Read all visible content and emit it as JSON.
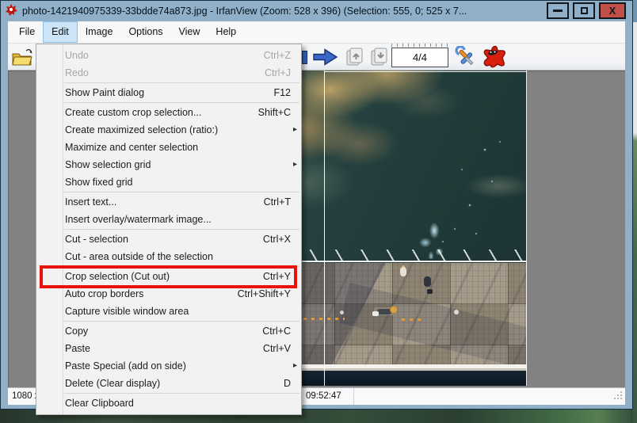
{
  "titlebar": {
    "title": "photo-1421940975339-33bdde74a873.jpg - IrfanView (Zoom: 528 x 396) (Selection: 555, 0; 525 x 7...",
    "close_label": "X"
  },
  "menubar": {
    "items": [
      "File",
      "Edit",
      "Image",
      "Options",
      "View",
      "Help"
    ],
    "active_item": "Edit"
  },
  "toolbar": {
    "page_counter": "4/4",
    "icons": [
      "open-folder-icon",
      "prev-file-icon",
      "next-file-icon",
      "page-up-icon",
      "page-down-icon",
      "settings-wrench-icon",
      "irfanview-mascot-icon"
    ]
  },
  "edit_menu": {
    "items": [
      {
        "label": "Undo",
        "shortcut": "Ctrl+Z",
        "disabled": true
      },
      {
        "label": "Redo",
        "shortcut": "Ctrl+J",
        "disabled": true
      },
      {
        "type": "separator"
      },
      {
        "label": "Show Paint dialog",
        "shortcut": "F12"
      },
      {
        "type": "separator"
      },
      {
        "label": "Create custom crop selection...",
        "shortcut": "Shift+C"
      },
      {
        "label": "Create maximized selection (ratio:)",
        "submenu": true
      },
      {
        "label": "Maximize and center selection"
      },
      {
        "label": "Show selection grid",
        "submenu": true
      },
      {
        "label": "Show fixed grid"
      },
      {
        "type": "separator"
      },
      {
        "label": "Insert text...",
        "shortcut": "Ctrl+T"
      },
      {
        "label": "Insert overlay/watermark image..."
      },
      {
        "type": "separator"
      },
      {
        "label": "Cut - selection",
        "shortcut": "Ctrl+X"
      },
      {
        "label": "Cut - area outside of the selection"
      },
      {
        "type": "separator"
      },
      {
        "label": "Crop selection (Cut out)",
        "shortcut": "Ctrl+Y",
        "highlighted": true
      },
      {
        "label": "Auto crop borders",
        "shortcut": "Ctrl+Shift+Y"
      },
      {
        "label": "Capture visible window area"
      },
      {
        "type": "separator"
      },
      {
        "label": "Copy",
        "shortcut": "Ctrl+C"
      },
      {
        "label": "Paste",
        "shortcut": "Ctrl+V"
      },
      {
        "label": "Paste Special (add on side)",
        "submenu": true
      },
      {
        "label": "Delete (Clear display)",
        "shortcut": "D"
      },
      {
        "type": "separator"
      },
      {
        "label": "Clear Clipboard"
      }
    ]
  },
  "statusbar": {
    "image_info": "1080 x",
    "time": "09:52:47"
  },
  "colors": {
    "annotation_red": "#e8130c",
    "titlebar_blue": "#8fb0c8",
    "close_button_red": "#c05048",
    "canvas_gray": "#828282"
  }
}
